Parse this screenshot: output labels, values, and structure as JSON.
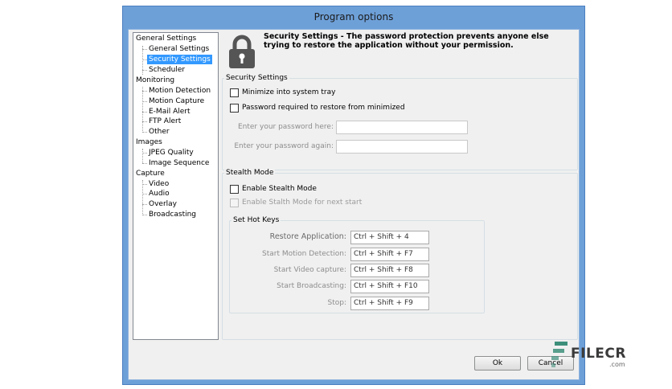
{
  "window": {
    "title": "Program options"
  },
  "tree": {
    "groups": [
      {
        "label": "General Settings",
        "children": [
          "General Settings",
          "Security Settings",
          "Scheduler"
        ]
      },
      {
        "label": "Monitoring",
        "children": [
          "Motion Detection",
          "Motion Capture",
          "E-Mail Alert",
          "FTP Alert",
          "Other"
        ]
      },
      {
        "label": "Images",
        "children": [
          "JPEG Quality",
          "Image Sequence"
        ]
      },
      {
        "label": "Capture",
        "children": [
          "Video",
          "Audio",
          "Overlay",
          "Broadcasting"
        ]
      }
    ],
    "selected": "Security Settings"
  },
  "header": {
    "icon": "lock-icon",
    "text": "Security Settings - The password protection prevents anyone else trying to restore the application without your permission."
  },
  "security": {
    "title": "Security Settings",
    "minimize_label": "Minimize into system tray",
    "minimize_checked": false,
    "password_required_label": "Password required to restore from minimized",
    "password_required_checked": false,
    "password_label": "Enter your password here:",
    "password_value": "",
    "password_again_label": "Enter your password again:",
    "password_again_value": ""
  },
  "stealth": {
    "title": "Stealth Mode",
    "enable_label": "Enable Stealth Mode",
    "enable_checked": false,
    "next_start_label": "Enable Stalth Mode for next start",
    "next_start_checked": false,
    "hotkeys_title": "Set Hot Keys",
    "hotkeys": [
      {
        "label": "Restore Application:",
        "value": "Ctrl + Shift + 4"
      },
      {
        "label": "Start Motion Detection:",
        "value": "Ctrl + Shift + F7"
      },
      {
        "label": "Start Video capture:",
        "value": "Ctrl + Shift + F8"
      },
      {
        "label": "Start Broadcasting:",
        "value": "Ctrl + Shift + F10"
      },
      {
        "label": "Stop:",
        "value": "Ctrl + Shift + F9"
      }
    ]
  },
  "buttons": {
    "ok": "Ok",
    "cancel": "Cancel"
  },
  "watermark": {
    "text": "FILECR",
    "sub": ".com"
  },
  "colors": {
    "titlebar": "#6ea0d8",
    "selection": "#3399ff",
    "client": "#f0f0f0"
  }
}
